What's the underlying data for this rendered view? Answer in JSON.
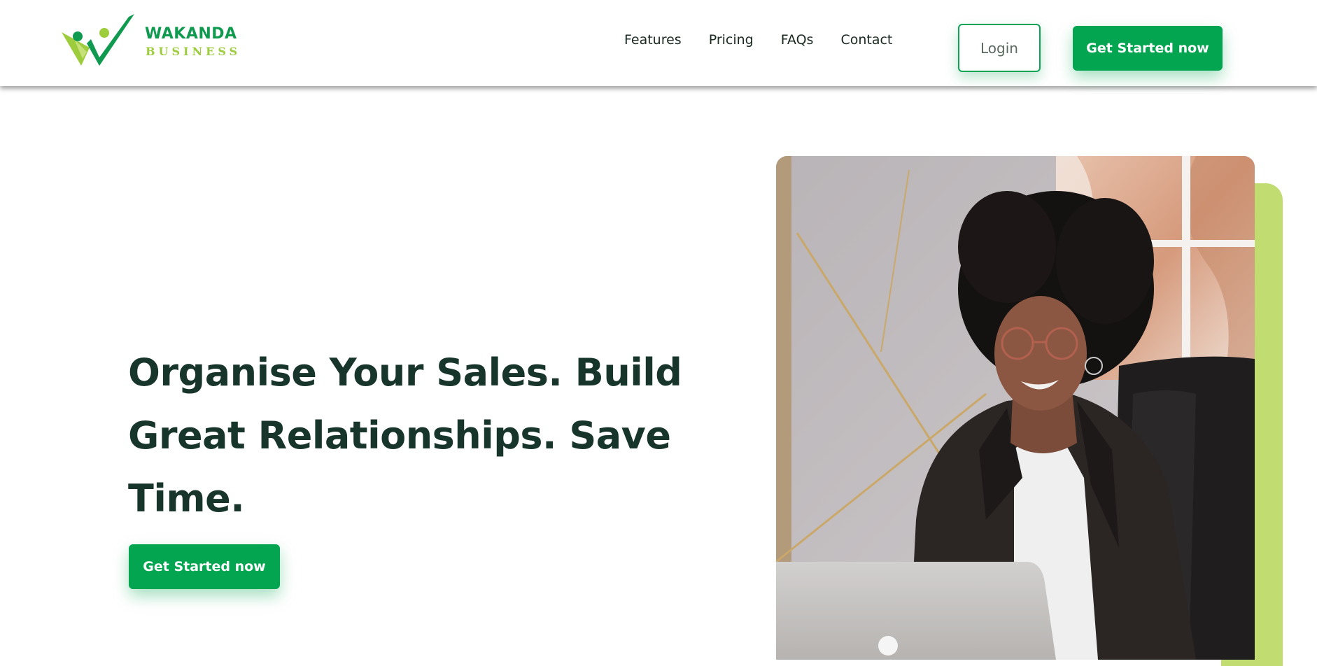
{
  "brand": {
    "name": "WAKANDA",
    "tagline": "BUSINESS",
    "primary_color": "#04a551",
    "accent_color": "#9dcc3d",
    "text_color": "#17352a"
  },
  "nav": {
    "items": [
      {
        "label": "Features"
      },
      {
        "label": "Pricing"
      },
      {
        "label": "FAQs"
      },
      {
        "label": "Contact"
      }
    ],
    "login_label": "Login",
    "cta_label": "Get Started now"
  },
  "hero": {
    "title_lines": [
      "Organise Your Sales. Build",
      "Great Relationships. Save",
      "Time."
    ],
    "cta_label": "Get Started now",
    "image": "woman-smiling-at-laptop-photo"
  }
}
